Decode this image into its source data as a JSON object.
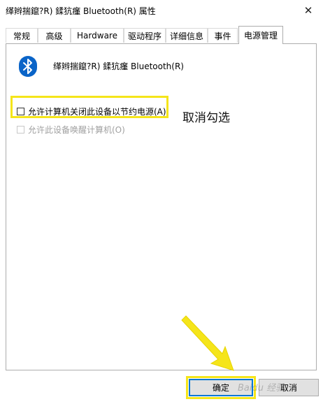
{
  "window": {
    "title": "缂辫揣鑹?R) 鍒犺瘽 Bluetooth(R) 属性",
    "close_glyph": "✕"
  },
  "tabs": [
    {
      "label": "常规",
      "active": false
    },
    {
      "label": "高级",
      "active": false
    },
    {
      "label": "Hardware",
      "active": false
    },
    {
      "label": "驱动程序",
      "active": false
    },
    {
      "label": "详细信息",
      "active": false
    },
    {
      "label": "事件",
      "active": false
    },
    {
      "label": "电源管理",
      "active": true
    }
  ],
  "device": {
    "icon": "bluetooth-icon",
    "name": "缂辫揣鑹?R) 鍒犺瘽 Bluetooth(R)",
    "icon_color": "#0a64c8"
  },
  "options": [
    {
      "label": "允许计算机关闭此设备以节约电源(A)",
      "checked": false,
      "enabled": true
    },
    {
      "label": "允许此设备唤醒计算机(O)",
      "checked": false,
      "enabled": false
    }
  ],
  "annotation": {
    "text": "取消勾选",
    "highlight_color": "#f5e51a"
  },
  "buttons": {
    "ok_label": "确定",
    "cancel_label": "取消"
  },
  "watermark": "Baidu 经验"
}
